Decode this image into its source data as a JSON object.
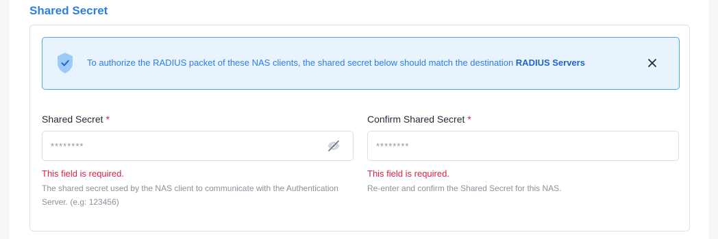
{
  "section": {
    "title": "Shared Secret"
  },
  "alert": {
    "text": "To authorize the RADIUS packet of these NAS clients, the shared secret below should match the destination",
    "emphasis": "RADIUS Servers",
    "icon": "shield-check-icon",
    "close_icon": "close-icon",
    "accent_color": "#2b7de9",
    "background_color": "#e8f3fe"
  },
  "fields": {
    "shared_secret": {
      "label": "Shared Secret",
      "required_mark": "*",
      "placeholder": "********",
      "error": "This field is required.",
      "help": "The shared secret used by the NAS client to communicate with the Authentication Server. (e.g: 123456)",
      "toggle_icon": "eye-slash-icon"
    },
    "confirm_shared_secret": {
      "label": "Confirm Shared Secret",
      "required_mark": "*",
      "placeholder": "********",
      "error": "This field is required.",
      "help": "Re-enter and confirm the Shared Secret for this NAS."
    }
  },
  "colors": {
    "title": "#2b7de9",
    "error": "#e11d48",
    "help": "#8a919c"
  }
}
